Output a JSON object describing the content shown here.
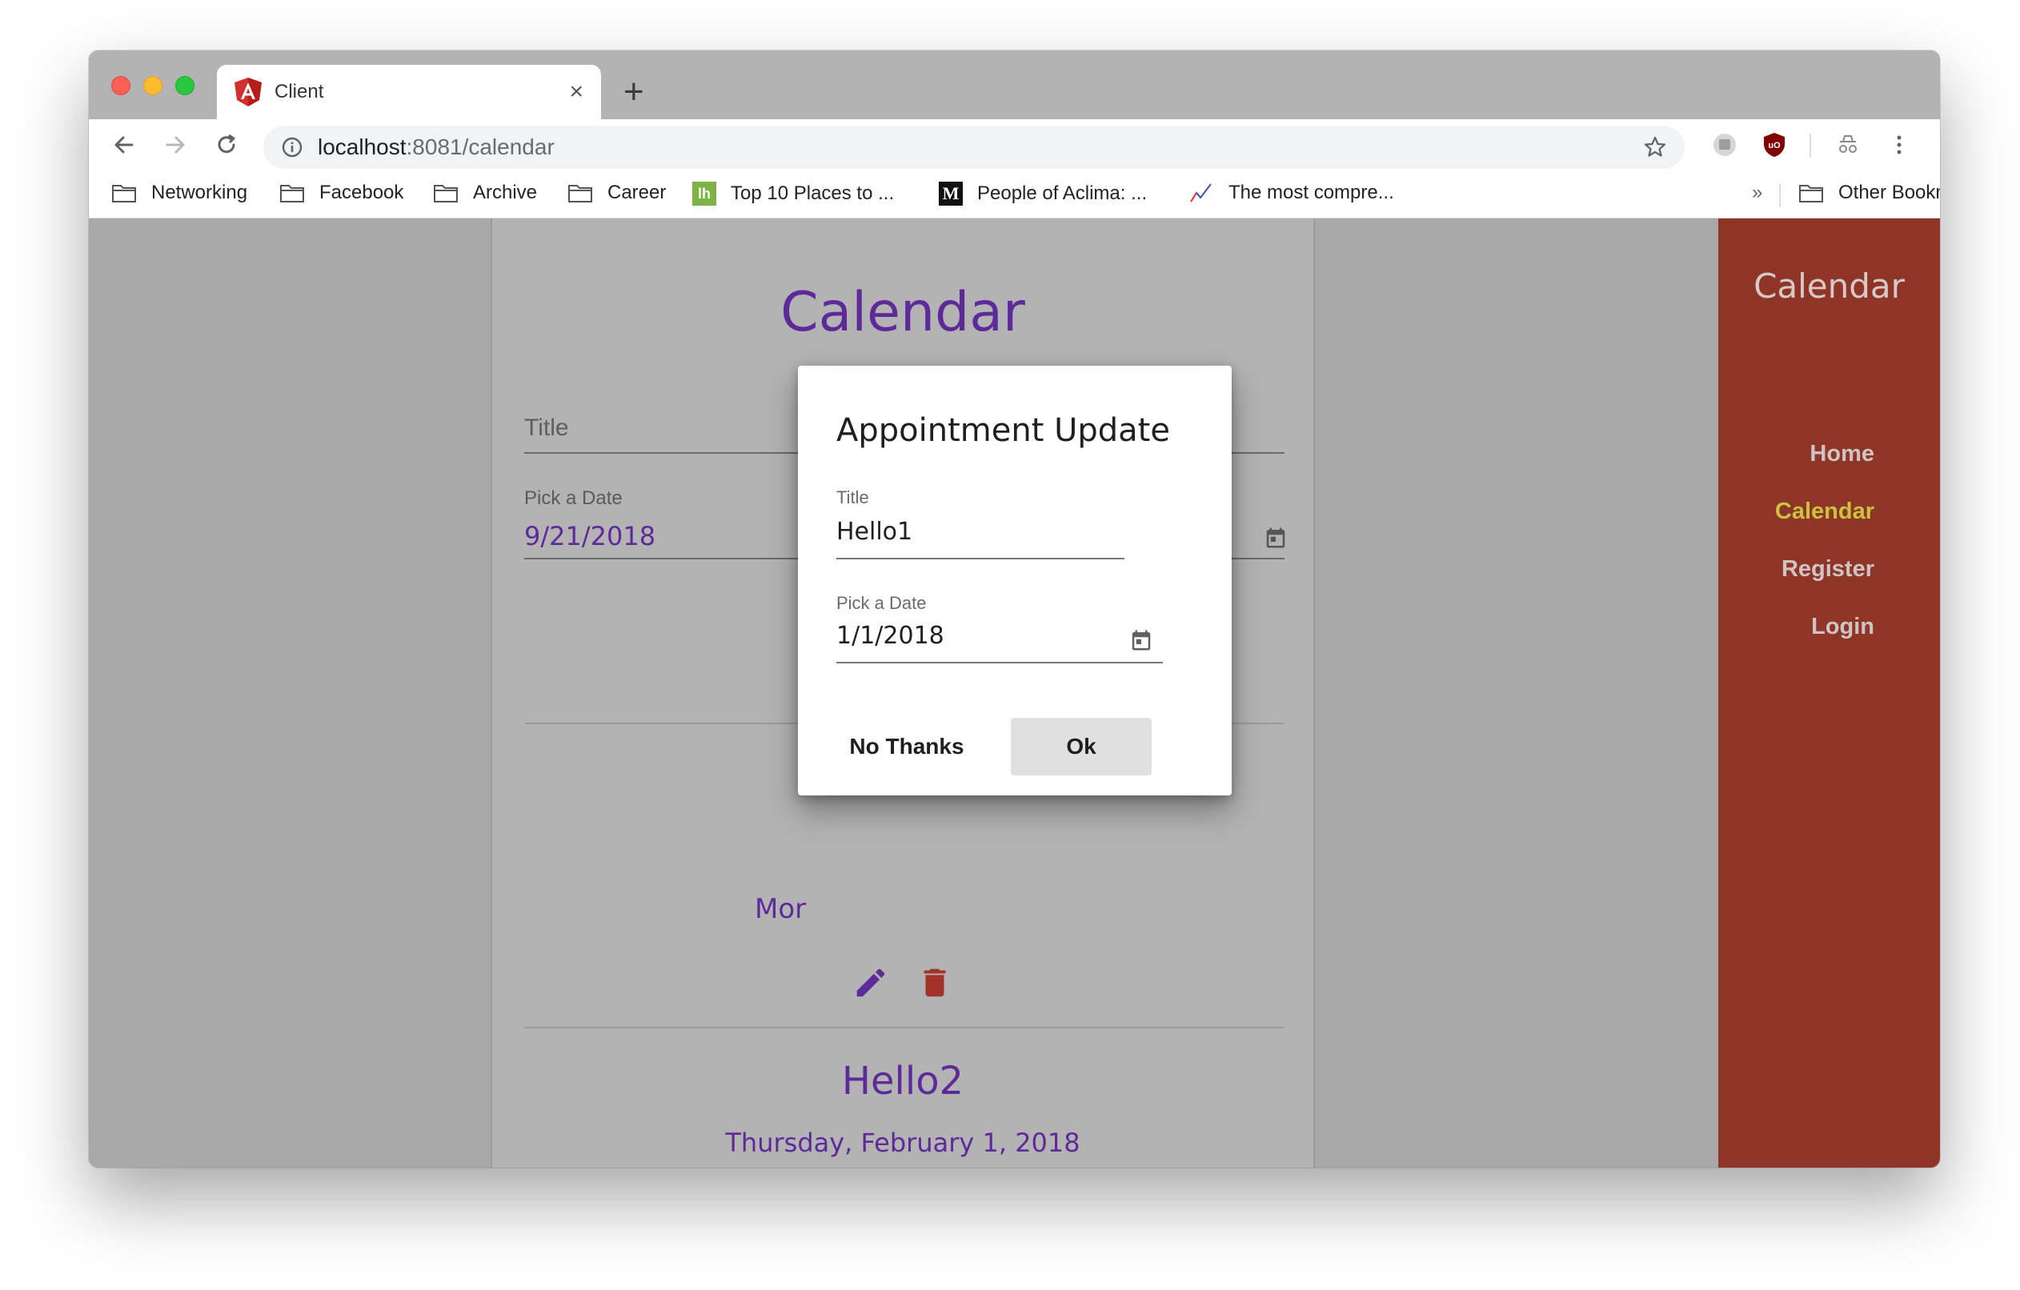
{
  "browser": {
    "tab": {
      "title": "Client",
      "close": "×"
    },
    "new_tab": "+",
    "url": {
      "host": "localhost",
      "rest": ":8081/calendar"
    },
    "bookmarks": [
      {
        "label": "Networking",
        "icon": "folder-icon"
      },
      {
        "label": "Facebook",
        "icon": "folder-icon"
      },
      {
        "label": "Archive",
        "icon": "folder-icon"
      },
      {
        "label": "Career",
        "icon": "folder-icon"
      },
      {
        "label": "Top 10 Places to ...",
        "icon": "lh-icon"
      },
      {
        "label": "People of Aclima: ...",
        "icon": "medium-icon"
      },
      {
        "label": "The most compre...",
        "icon": "chart-icon"
      }
    ],
    "bookmarks_overflow": "»",
    "other_bookmarks": "Other Bookmarks",
    "medium_glyph": "M",
    "lh_glyph": "lh"
  },
  "page": {
    "heading": "Calendar",
    "title_field": {
      "label": "Title"
    },
    "date_field": {
      "label": "Pick a Date",
      "value": "9/21/2018"
    },
    "partial_text": "Mor",
    "appointment2": {
      "title": "Hello2",
      "date": "Thursday, February 1, 2018"
    }
  },
  "sidebar": {
    "title": "Calendar",
    "links": [
      {
        "label": "Home",
        "active": false
      },
      {
        "label": "Calendar",
        "active": true
      },
      {
        "label": "Register",
        "active": false
      },
      {
        "label": "Login",
        "active": false
      }
    ]
  },
  "dialog": {
    "title": "Appointment Update",
    "title_label": "Title",
    "title_value": "Hello1",
    "date_label": "Pick a Date",
    "date_value": "1/1/2018",
    "cancel_label": "No Thanks",
    "ok_label": "Ok"
  },
  "colors": {
    "accent_purple": "#5e2a9a",
    "sidebar_bg": "#8e3528",
    "active_link": "#c9c33e",
    "delete_red": "#a3332a"
  }
}
